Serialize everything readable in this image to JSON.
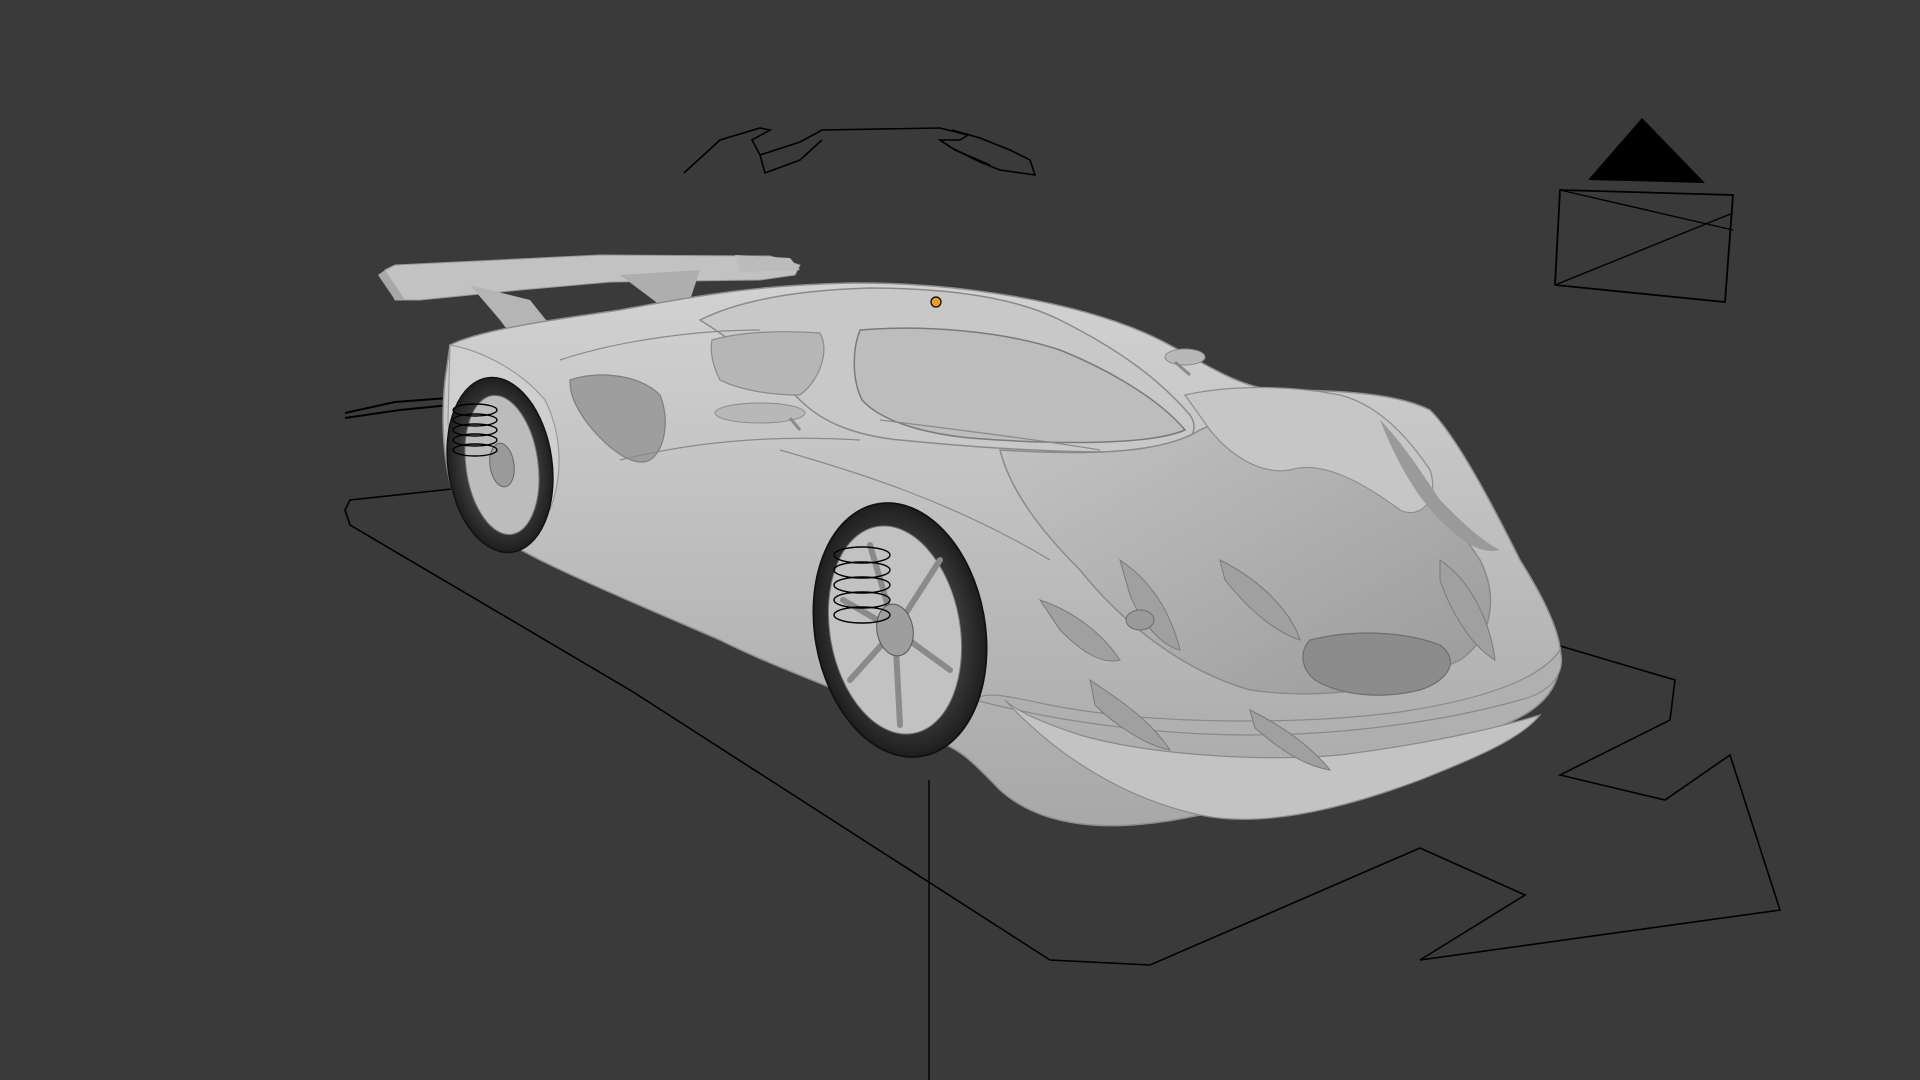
{
  "viewport": {
    "background": "#3a3a3a",
    "car_color": "#c9c9c9",
    "outline_color": "#000000",
    "origin_color": "#f0a020"
  },
  "objects": {
    "car": {
      "icon": "car-mesh"
    },
    "camera": {
      "icon": "camera-gizmo"
    },
    "rig_controls": {
      "icon": "armature-controls"
    }
  }
}
